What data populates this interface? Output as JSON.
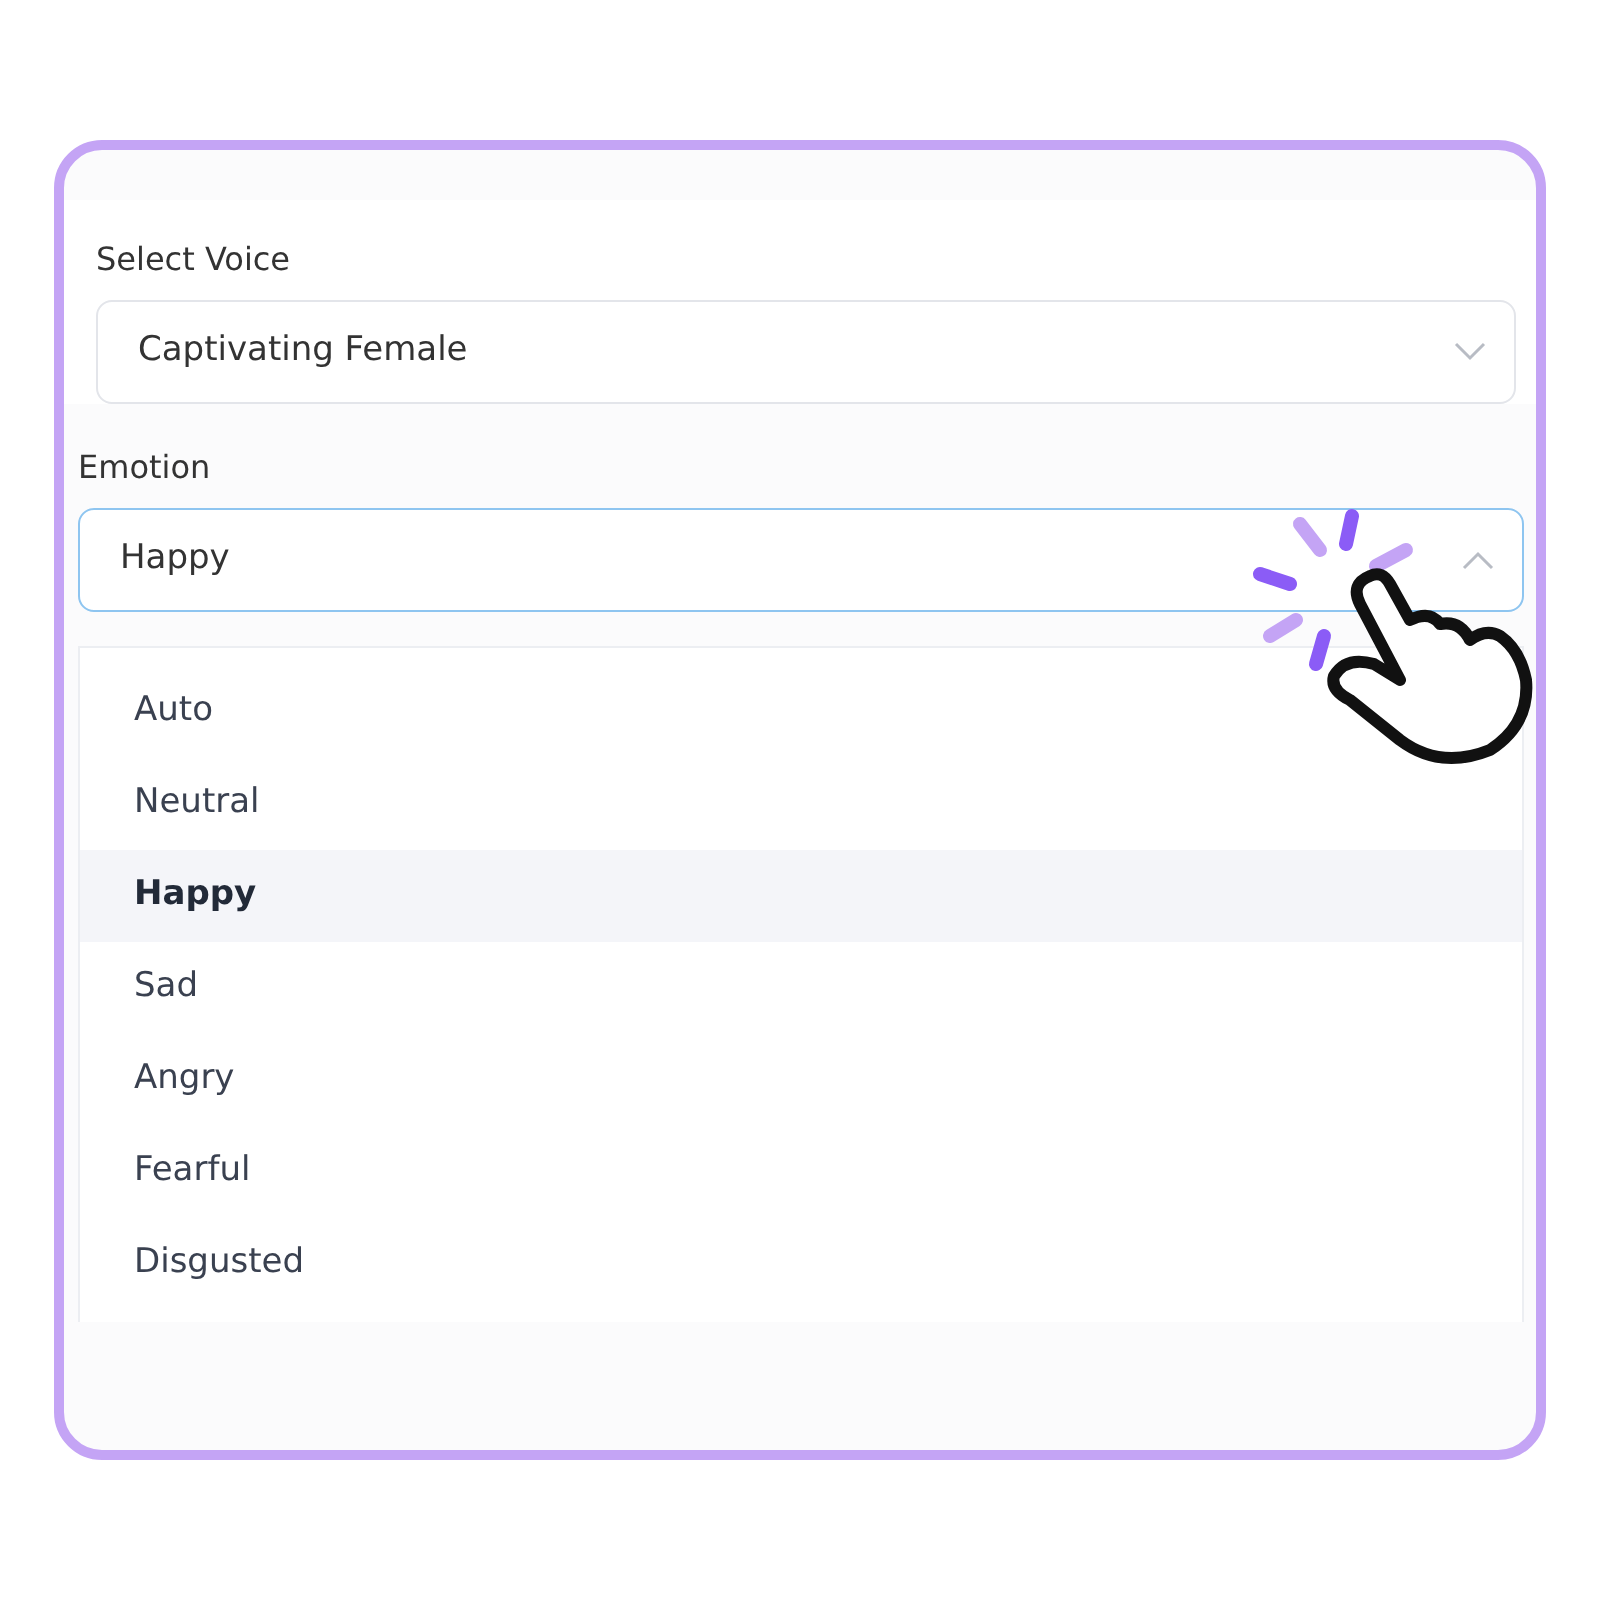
{
  "voice": {
    "label": "Select Voice",
    "value": "Captivating Female"
  },
  "emotion": {
    "label": "Emotion",
    "value": "Happy",
    "expanded": true,
    "options": [
      {
        "label": "Auto",
        "selected": false
      },
      {
        "label": "Neutral",
        "selected": false
      },
      {
        "label": "Happy",
        "selected": true
      },
      {
        "label": "Sad",
        "selected": false
      },
      {
        "label": "Angry",
        "selected": false
      },
      {
        "label": "Fearful",
        "selected": false
      },
      {
        "label": "Disgusted",
        "selected": false
      }
    ]
  }
}
